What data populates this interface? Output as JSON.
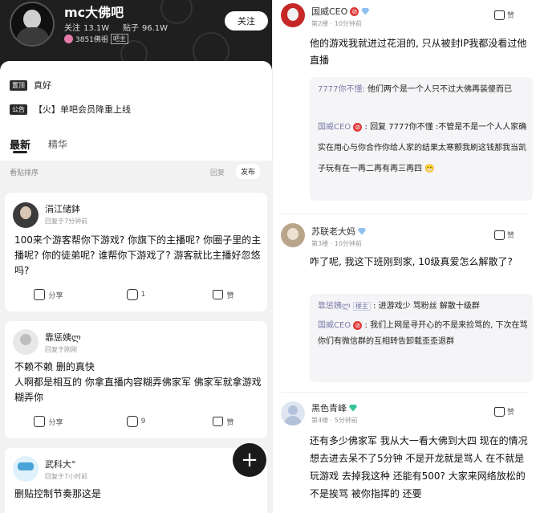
{
  "left": {
    "forum": {
      "name": "mc大佛吧",
      "follow_label": "关注",
      "followers_label": "关注",
      "followers": "13.1W",
      "posts_label": "贴子",
      "posts": "96.1W",
      "rank_text": "3851佛祖",
      "rank_badge": "吧主",
      "follow_button": "关注"
    },
    "pinned": [
      {
        "tag": "置顶",
        "text": "真好"
      },
      {
        "tag": "公告",
        "text": "【火】单吧会员降重上线"
      }
    ],
    "tabs": [
      "最新",
      "精华"
    ],
    "sort": {
      "label": "看贴排序",
      "reply": "回复",
      "post": "发布"
    },
    "posts": [
      {
        "user": "涓江储鉢",
        "time": "回复于7分钟前",
        "text": "100来个游客帮你下游戏? 你旗下的主播呢? 你圈子里的主播呢? 你的徒弟呢? 谁帮你下游戏了? 游客就比主播好忽悠吗?",
        "share": "分享",
        "comments": "1",
        "like": "赞"
      },
      {
        "user": "靠惩姨ლ",
        "time": "回复于刚刚",
        "text_lines": [
          "不赖不赖  删的真快",
          "人啊都是相互的 你拿直播内容糊弄佛家军 佛家军就拿游戏糊弄你"
        ],
        "share": "分享",
        "comments": "9",
        "like": "赞"
      },
      {
        "user": "武科大°",
        "time": "回复于7小时前",
        "text": "删贴控制节奏那这是"
      }
    ],
    "fab": "+"
  },
  "right": {
    "comments": [
      {
        "user": "国威CEO",
        "floor": "第2楼",
        "time": "10分钟前",
        "like": "赞",
        "text": "他的游戏我就进过花泪的, 只从被封IP我都没看过他直播",
        "quotes": [
          {
            "name": "7777你不懂:",
            "text": "他们两个是一个人只不过大佛再装傻而已"
          },
          {
            "name": "国威CEO",
            "text": ": 回复 7777你不懂 :不管是不是一个人人家确实在用心与你合作你给人家的结果太寒颤我刷这钱那我当凯子玩有在一再二再有再三再四 😬"
          }
        ]
      },
      {
        "user": "苏联老大妈",
        "floor": "第3楼",
        "time": "10分钟前",
        "like": "赞",
        "text": "咋了呢, 我这下班刚到家, 10级真爱怎么解散了?",
        "quotes": [
          {
            "name": "靠惩姨ლ",
            "badge": "楼主",
            "text": ": 进游戏少 骂粉丝 解散十级群"
          },
          {
            "name": "国威CEO",
            "text": ": 我们上网是寻开心的不是来捡骂的, 下次在骂你们有微信群的互相转告卸载歪歪退群"
          }
        ]
      },
      {
        "user": "黑色青峰",
        "floor": "第4楼",
        "time": "5分钟前",
        "like": "赞",
        "text": "还有多少佛家军 我从大一看大佛到大四 现在的情况想去进去呆不了5分钟 不是开龙就是骂人 在不就是玩游戏 去掉我这种 还能有500? 大家来网络放松的 不是挨骂 被你指挥的 还要"
      }
    ]
  },
  "colors": {
    "banner": "#1f1f1f",
    "quote_bg": "#f5f5f7",
    "quote_name": "#7a7aa8",
    "ban_icon": "#e03a3a"
  }
}
